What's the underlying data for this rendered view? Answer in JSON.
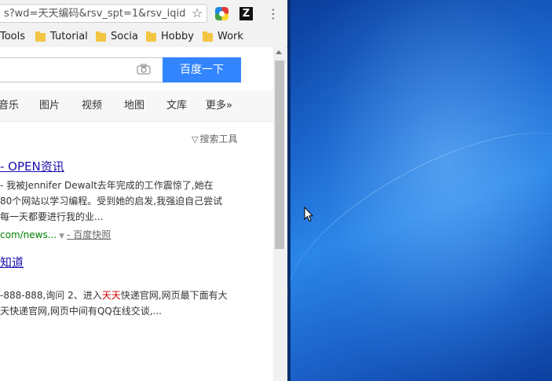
{
  "browser": {
    "url": "s?wd=天天编码&rsv_spt=1&rsv_iqid",
    "bookmarks": [
      "Tools",
      "Tutorial",
      "Socia",
      "Hobby",
      "Work"
    ],
    "ext2_letter": "Z"
  },
  "search": {
    "button_label": "百度一下"
  },
  "nav": {
    "tabs": [
      "音乐",
      "图片",
      "视频",
      "地图",
      "文库",
      "更多»"
    ]
  },
  "tools_label": "搜索工具",
  "results": [
    {
      "title": "- OPEN资讯",
      "lines": [
        "- 我被Jennifer Dewalt去年完成的工作震惊了,她在",
        "80个网站以学习编程。受到她的启发,我强迫自己尝试",
        "每一天都要进行我的业..."
      ],
      "url": "com/news...",
      "snapshot": "- 百度快照"
    },
    {
      "title": "知道",
      "line1_pre": "-888-888,询问 2、进入",
      "line1_hl": "天天",
      "line1_post": "快递官网,网页最下面有大",
      "line2": "天快递官网,网页中间有QQ在线交谈,..."
    }
  ],
  "colors": {
    "search_button": "#3385ff",
    "link": "#1a0dab",
    "url_green": "#008000",
    "highlight": "#c00"
  }
}
